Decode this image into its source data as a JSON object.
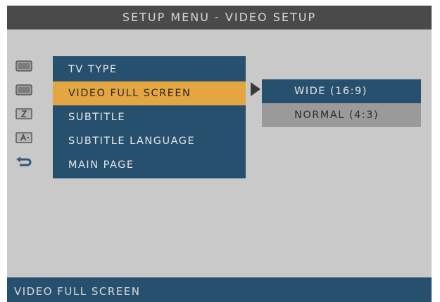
{
  "header": {
    "title": "SETUP MENU - VIDEO SETUP"
  },
  "menu": {
    "items": [
      {
        "label": "TV TYPE",
        "icon": "tv-icon"
      },
      {
        "label": "VIDEO FULL SCREEN",
        "icon": "screen-icon"
      },
      {
        "label": "SUBTITLE",
        "icon": "subtitle-icon"
      },
      {
        "label": "SUBTITLE LANGUAGE",
        "icon": "language-icon"
      },
      {
        "label": "MAIN PAGE",
        "icon": "return-arrow-icon"
      }
    ],
    "selected_index": 1
  },
  "submenu": {
    "options": [
      {
        "label": "WIDE (16:9)"
      },
      {
        "label": "NORMAL (4:3)"
      }
    ],
    "selected_index": 0
  },
  "status": {
    "text": "VIDEO FULL SCREEN"
  },
  "colors": {
    "menu_bg": "#27506f",
    "highlight": "#e3a640",
    "background": "#c9c9c9",
    "title_bar": "#4a4a4a"
  }
}
